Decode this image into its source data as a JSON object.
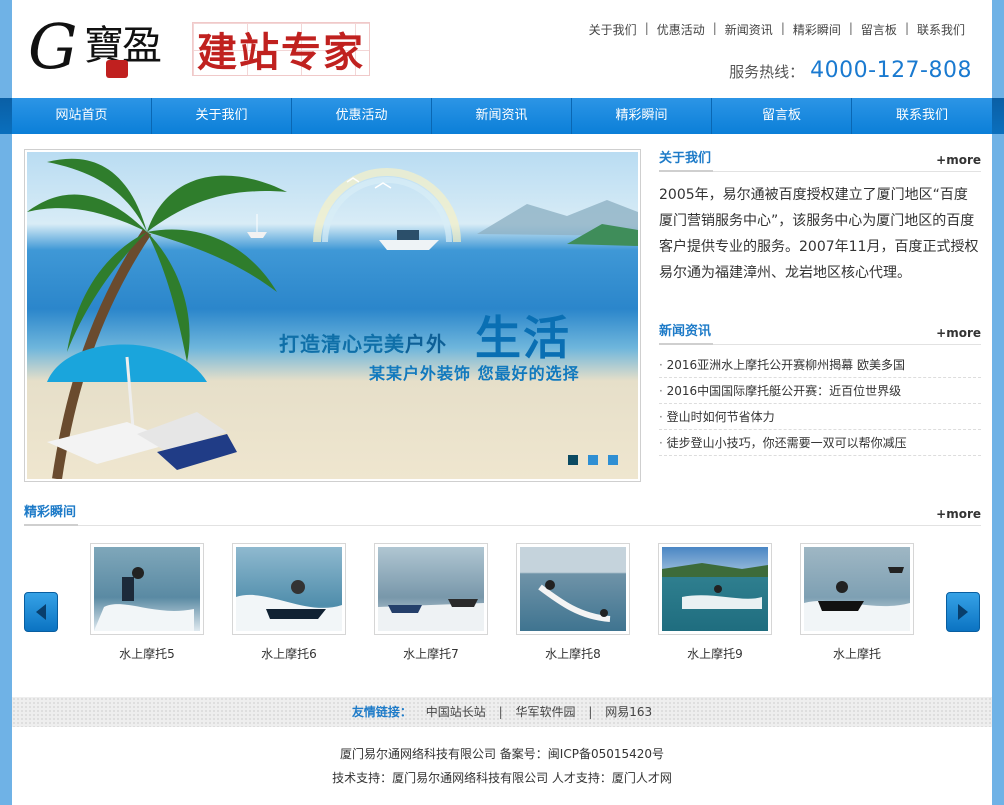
{
  "header": {
    "logo_letter": "G",
    "logo_chars": "寶盈",
    "logo_title": "建站专家",
    "top_links": [
      "关于我们",
      "优惠活动",
      "新闻资讯",
      "精彩瞬间",
      "留言板",
      "联系我们"
    ],
    "hotline_label": "服务热线：",
    "hotline_number": "4000-127-808"
  },
  "nav": {
    "items": [
      "网站首页",
      "关于我们",
      "优惠活动",
      "新闻资讯",
      "精彩瞬间",
      "留言板",
      "联系我们"
    ]
  },
  "banner": {
    "line1_part1": "打造清心完美",
    "line1_part2": "户外",
    "big": "生活",
    "line2": "某某户外装饰  您最好的选择",
    "slide_count": 3,
    "active_slide": 1
  },
  "about": {
    "title": "关于我们",
    "more": "+more",
    "text": "2005年，易尔通被百度授权建立了厦门地区“百度厦门营销服务中心”，该服务中心为厦门地区的百度客户提供专业的服务。2007年11月，百度正式授权易尔通为福建漳州、龙岩地区核心代理。"
  },
  "news": {
    "title": "新闻资讯",
    "more": "+more",
    "items": [
      "2016亚洲水上摩托公开赛柳州揭幕 欧美多国",
      "2016中国国际摩托艇公开赛：近百位世界级",
      "登山时如何节省体力",
      "徒步登山小技巧，你还需要一双可以帮你减压"
    ]
  },
  "gallery": {
    "title": "精彩瞬间",
    "more": "+more",
    "items": [
      "水上摩托5",
      "水上摩托6",
      "水上摩托7",
      "水上摩托8",
      "水上摩托9",
      "水上摩托"
    ]
  },
  "footer": {
    "links_label": "友情链接：",
    "links": [
      "中国站长站",
      "华军软件园",
      "网易163"
    ],
    "line1": "厦门易尔通网络科技有限公司 备案号：闽ICP备05015420号",
    "line2": "技术支持：厦门易尔通网络科技有限公司 人才支持：厦门人才网"
  },
  "colors": {
    "brand_blue": "#0b7fd8",
    "title_blue": "#1e7bc8",
    "logo_red": "#c0211f"
  },
  "icons": [
    "arrow-left-icon",
    "arrow-right-icon"
  ]
}
